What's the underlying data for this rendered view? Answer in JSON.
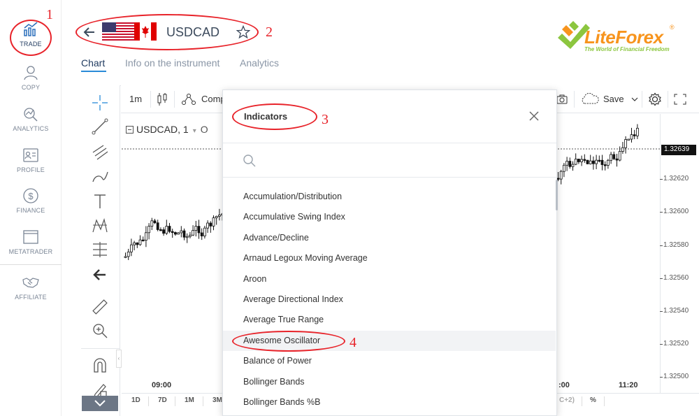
{
  "nav": {
    "items": [
      {
        "label": "TRADE"
      },
      {
        "label": "COPY"
      },
      {
        "label": "ANALYTICS"
      },
      {
        "label": "PROFILE"
      },
      {
        "label": "FINANCE"
      },
      {
        "label": "METATRADER"
      },
      {
        "label": "AFFILIATE"
      }
    ]
  },
  "header": {
    "symbol": "USDCAD",
    "tabs": [
      {
        "label": "Chart",
        "active": true
      },
      {
        "label": "Info on the instrument",
        "active": false
      },
      {
        "label": "Analytics",
        "active": false
      }
    ],
    "logo": {
      "brand": "LiteForex",
      "registered": "®",
      "tagline": "The World of Financial Freedom"
    }
  },
  "annotations": {
    "n1": "1",
    "n2": "2",
    "n3": "3",
    "n4": "4"
  },
  "toolbar": {
    "interval": "1m",
    "compare": "Comp",
    "save": "Save"
  },
  "chart": {
    "title": "USDCAD, 1",
    "title_suffix": "O",
    "current_price": "1.32639",
    "price_ticks": [
      "1.32620",
      "1.32600",
      "1.32580",
      "1.32560",
      "1.32540",
      "1.32520",
      "1.32500"
    ],
    "time_ticks": [
      "09:00",
      ":00",
      "11:20"
    ],
    "periods": [
      "1D",
      "7D",
      "1M",
      "3M"
    ],
    "right_tail": [
      "C+2)",
      "%"
    ]
  },
  "modal": {
    "title": "Indicators",
    "search_placeholder": "",
    "items": [
      "Accumulation/Distribution",
      "Accumulative Swing Index",
      "Advance/Decline",
      "Arnaud Legoux Moving Average",
      "Aroon",
      "Average Directional Index",
      "Average True Range",
      "Awesome Oscillator",
      "Balance of Power",
      "Bollinger Bands",
      "Bollinger Bands %B"
    ],
    "highlighted_index": 7
  },
  "colors": {
    "accent": "#2a8bd8",
    "annotation": "#e8232a",
    "logo_green": "#8cc63f",
    "logo_orange": "#f7941d"
  }
}
